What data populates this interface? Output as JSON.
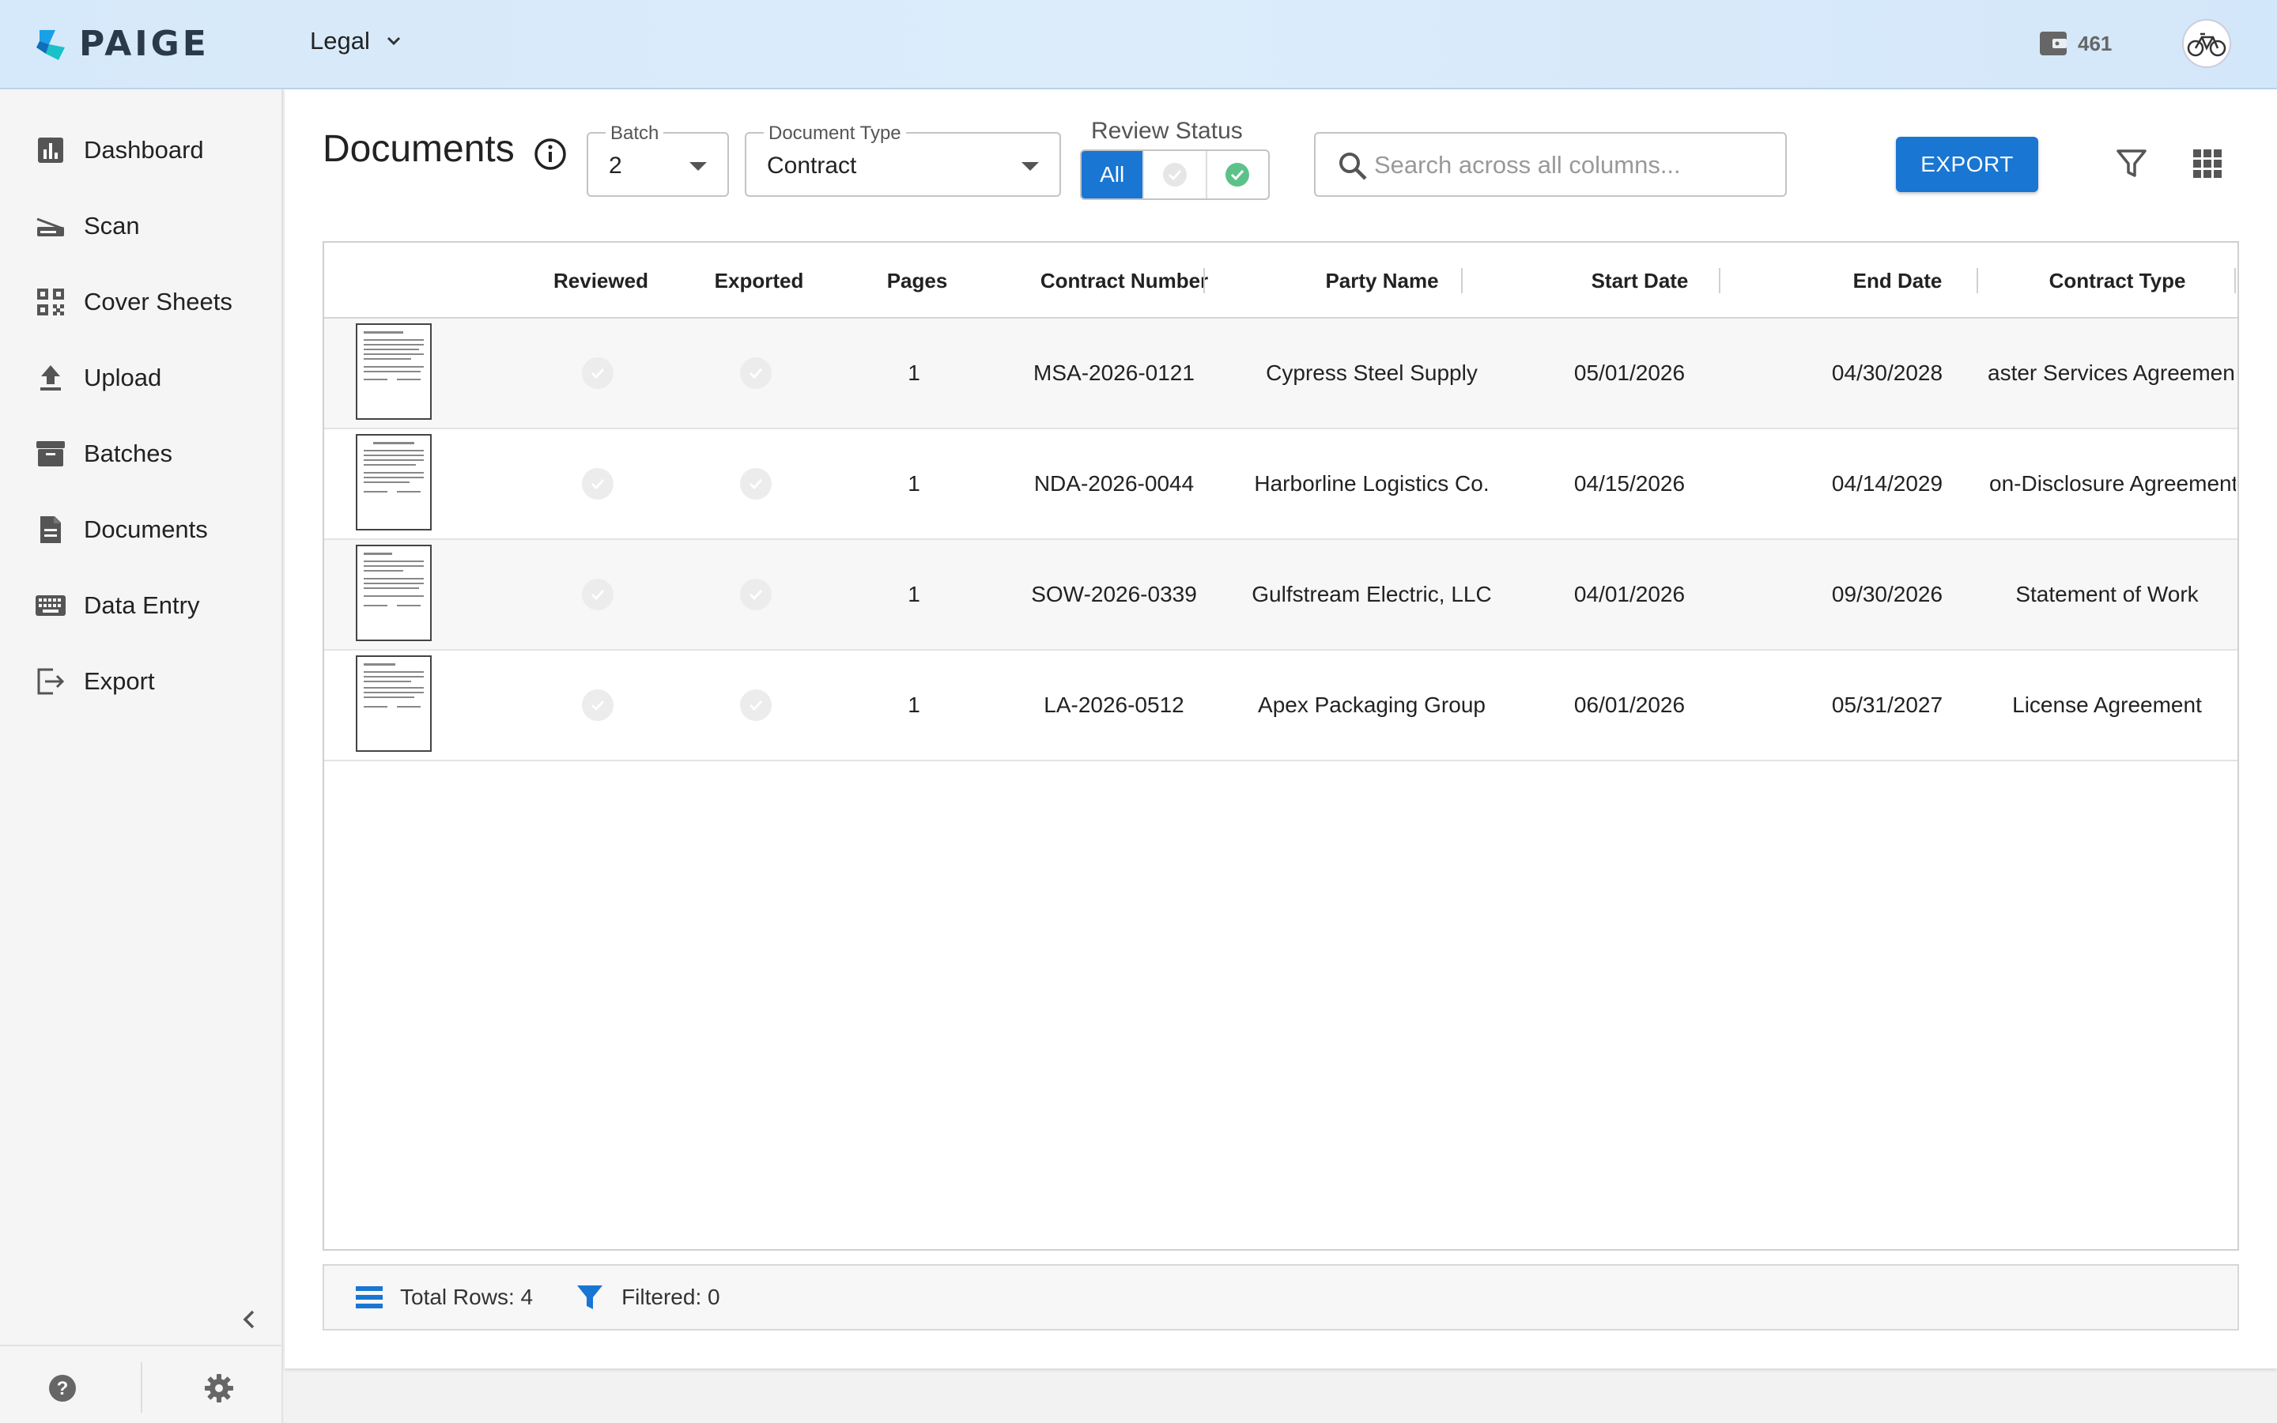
{
  "app": {
    "brand": "PAIGE",
    "organization": "Legal",
    "credits": "461"
  },
  "sidebar": {
    "items": [
      {
        "label": "Dashboard",
        "icon": "bar-chart-icon"
      },
      {
        "label": "Scan",
        "icon": "scanner-icon"
      },
      {
        "label": "Cover Sheets",
        "icon": "qr-code-icon"
      },
      {
        "label": "Upload",
        "icon": "upload-icon"
      },
      {
        "label": "Batches",
        "icon": "archive-box-icon"
      },
      {
        "label": "Documents",
        "icon": "document-icon"
      },
      {
        "label": "Data Entry",
        "icon": "keyboard-icon"
      },
      {
        "label": "Export",
        "icon": "export-icon"
      }
    ]
  },
  "toolbar": {
    "title": "Documents",
    "batch": {
      "label": "Batch",
      "value": "2"
    },
    "document_type": {
      "label": "Document Type",
      "value": "Contract"
    },
    "review_status": {
      "label": "Review Status",
      "all_label": "All"
    },
    "search_placeholder": "Search across all columns...",
    "export_label": "EXPORT"
  },
  "table": {
    "columns": [
      "Reviewed",
      "Exported",
      "Pages",
      "Contract Number",
      "Party Name",
      "Start Date",
      "End Date",
      "Contract Type"
    ],
    "rows": [
      {
        "pages": "1",
        "contract_number": "MSA-2026-0121",
        "party_name": "Cypress Steel Supply",
        "start_date": "05/01/2026",
        "end_date": "04/30/2028",
        "contract_type": "aster Services Agreemen"
      },
      {
        "pages": "1",
        "contract_number": "NDA-2026-0044",
        "party_name": "Harborline Logistics Co.",
        "start_date": "04/15/2026",
        "end_date": "04/14/2029",
        "contract_type": "on-Disclosure Agreement"
      },
      {
        "pages": "1",
        "contract_number": "SOW-2026-0339",
        "party_name": "Gulfstream Electric, LLC",
        "start_date": "04/01/2026",
        "end_date": "09/30/2026",
        "contract_type": "Statement of Work"
      },
      {
        "pages": "1",
        "contract_number": "LA-2026-0512",
        "party_name": "Apex Packaging Group",
        "start_date": "06/01/2026",
        "end_date": "05/31/2027",
        "contract_type": "License Agreement"
      }
    ]
  },
  "status_bar": {
    "total_rows": "Total Rows: 4",
    "filtered": "Filtered: 0"
  },
  "colors": {
    "primary": "#1976d2",
    "success": "#5cc28a",
    "header_bg": "#d6e9fa"
  }
}
